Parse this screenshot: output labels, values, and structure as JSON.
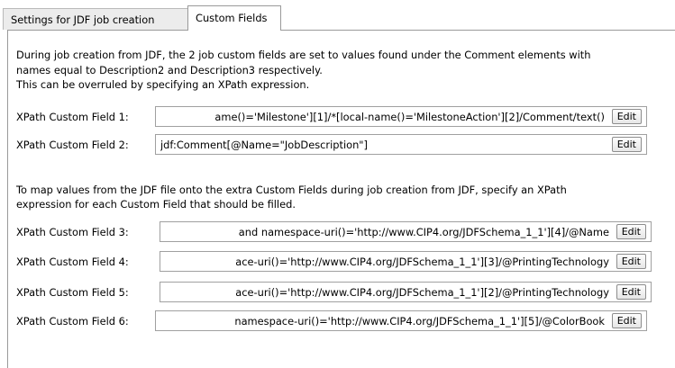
{
  "tabs": [
    {
      "label": "Settings for JDF job creation",
      "active": false
    },
    {
      "label": "Custom Fields",
      "active": true
    }
  ],
  "intro": {
    "line1": "During job creation from JDF, the 2 job custom fields are set to values found under the Comment elements with",
    "line2": "names equal to Description2 and Description3 respectively.",
    "line3": "This can be overruled by specifying an XPath expression."
  },
  "fields_top": [
    {
      "label": "XPath Custom Field 1:",
      "value": "ame()='Milestone'][1]/*[local-name()='MilestoneAction'][2]/Comment/text()",
      "edit": "Edit"
    },
    {
      "label": "XPath Custom Field 2:",
      "value": "jdf:Comment[@Name=\"JobDescription\"]",
      "edit": "Edit"
    }
  ],
  "extra": {
    "line1": "To map values from the JDF file onto the extra Custom Fields during job creation from JDF, specify an XPath",
    "line2": "expression for each Custom Field that should be filled."
  },
  "fields_bottom": [
    {
      "label": "XPath Custom Field 3:",
      "value": "and namespace-uri()='http://www.CIP4.org/JDFSchema_1_1'][4]/@Name",
      "edit": "Edit"
    },
    {
      "label": "XPath Custom Field 4:",
      "value": "ace-uri()='http://www.CIP4.org/JDFSchema_1_1'][3]/@PrintingTechnology",
      "edit": "Edit"
    },
    {
      "label": "XPath Custom Field 5:",
      "value": "ace-uri()='http://www.CIP4.org/JDFSchema_1_1'][2]/@PrintingTechnology",
      "edit": "Edit"
    },
    {
      "label": "XPath Custom Field 6:",
      "value": "namespace-uri()='http://www.CIP4.org/JDFSchema_1_1'][5]/@ColorBook",
      "edit": "Edit"
    }
  ]
}
